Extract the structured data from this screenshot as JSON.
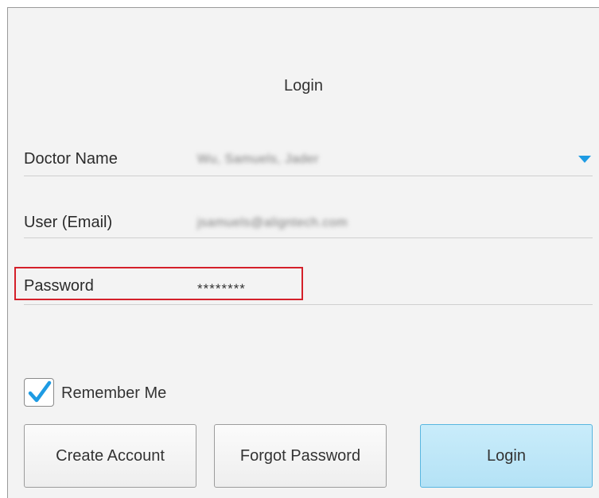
{
  "form": {
    "title": "Login",
    "doctor": {
      "label": "Doctor Name",
      "value": "Wu, Samuels, Jader"
    },
    "user": {
      "label": "User (Email)",
      "value": "jsamuels@aligntech.com"
    },
    "password": {
      "label": "Password",
      "value": "********"
    },
    "remember": {
      "label": "Remember Me",
      "checked": true
    }
  },
  "buttons": {
    "create_account": "Create Account",
    "forgot_password": "Forgot Password",
    "login": "Login"
  },
  "colors": {
    "accent": "#1e9be3",
    "highlight": "#d4202a",
    "primary_button": "#b4e2f6"
  },
  "icons": {
    "dropdown": "chevron-down-icon",
    "checkmark": "checkmark-icon"
  }
}
